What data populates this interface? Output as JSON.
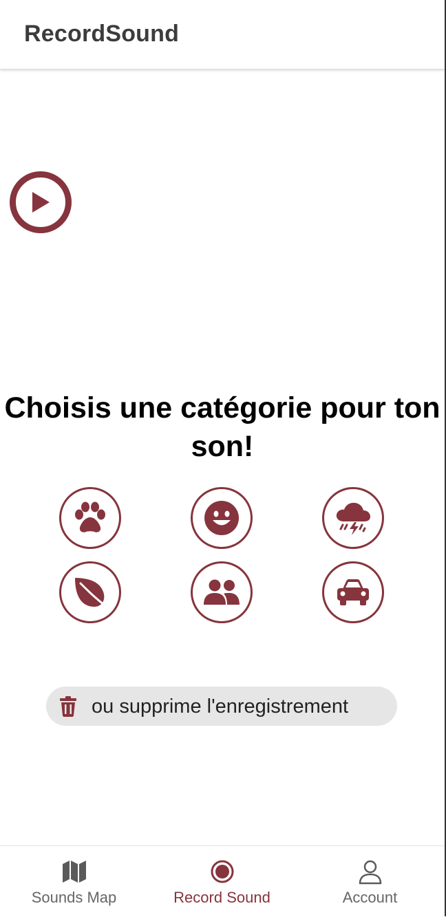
{
  "colors": {
    "accent": "#86343d",
    "nav_inactive": "#666666",
    "pill_background": "#e6e6e6"
  },
  "header": {
    "title": "RecordSound"
  },
  "player": {
    "icon": "play-icon"
  },
  "prompt": {
    "text": "Choisis une catégorie pour ton son!"
  },
  "categories": [
    {
      "icon": "paw-icon"
    },
    {
      "icon": "smile-icon"
    },
    {
      "icon": "storm-cloud-icon"
    },
    {
      "icon": "leaf-icon"
    },
    {
      "icon": "users-icon"
    },
    {
      "icon": "car-icon"
    }
  ],
  "delete_action": {
    "icon": "trash-icon",
    "label": "ou supprime l'enregistrement"
  },
  "bottom_nav": {
    "active": "Record Sound",
    "items": [
      {
        "label": "Sounds Map",
        "icon": "map-icon"
      },
      {
        "label": "Record Sound",
        "icon": "record-icon"
      },
      {
        "label": "Account",
        "icon": "person-icon"
      }
    ]
  }
}
